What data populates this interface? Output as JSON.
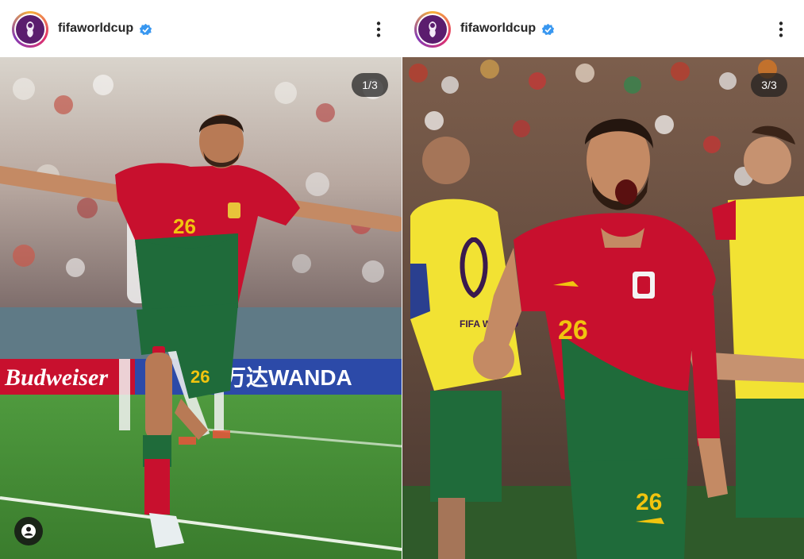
{
  "posts": [
    {
      "account": "fifaworldcup",
      "verified": true,
      "carousel_counter": "1/3",
      "photo": {
        "description_icon": "photo",
        "shirt_number": "26",
        "board_texts": [
          "Budweiser",
          "万达WANDA"
        ]
      },
      "user_tag_icon": "person-icon"
    },
    {
      "account": "fifaworldcup",
      "verified": true,
      "carousel_counter": "3/3",
      "photo": {
        "description_icon": "photo",
        "shirt_number": "26",
        "bib_text": "FIFA WORLD Cup Qatar 2022"
      }
    }
  ],
  "colors": {
    "portugal_red": "#c8102e",
    "portugal_green": "#1f6b3a",
    "bib_yellow": "#f2e233",
    "pitch_green": "#3f8c34",
    "verified_blue": "#3897f0"
  }
}
